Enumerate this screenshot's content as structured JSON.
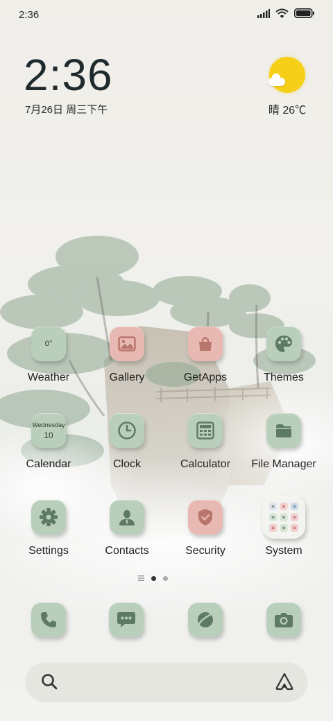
{
  "status_bar": {
    "time": "2:36",
    "icons": [
      "signal-icon",
      "wifi-icon",
      "battery-icon"
    ]
  },
  "clock_widget": {
    "time": "2:36",
    "date": "7月26日 周三下午"
  },
  "weather_widget": {
    "icon": "sunny-cloud-icon",
    "text": "晴 26℃"
  },
  "apps": [
    {
      "label": "Weather",
      "icon": "weather-icon",
      "color": "green",
      "icon_text": "0°"
    },
    {
      "label": "Gallery",
      "icon": "gallery-icon",
      "color": "pink"
    },
    {
      "label": "GetApps",
      "icon": "shopping-bag-icon",
      "color": "pink"
    },
    {
      "label": "Themes",
      "icon": "palette-icon",
      "color": "green"
    },
    {
      "label": "Calendar",
      "icon": "calendar-icon",
      "color": "green",
      "icon_text": "Wednesday",
      "icon_subtext": "10"
    },
    {
      "label": "Clock",
      "icon": "clock-icon",
      "color": "green"
    },
    {
      "label": "Calculator",
      "icon": "calculator-icon",
      "color": "green"
    },
    {
      "label": "File Manager",
      "icon": "folder-icon",
      "color": "green"
    },
    {
      "label": "Settings",
      "icon": "gear-icon",
      "color": "green"
    },
    {
      "label": "Contacts",
      "icon": "person-icon",
      "color": "green"
    },
    {
      "label": "Security",
      "icon": "shield-icon",
      "color": "pink"
    },
    {
      "label": "System",
      "icon": "folder-grid-icon",
      "color": "light"
    }
  ],
  "page_indicator": {
    "pages": 2,
    "current": 1
  },
  "dock": [
    {
      "icon": "phone-icon"
    },
    {
      "icon": "message-icon"
    },
    {
      "icon": "browser-icon"
    },
    {
      "icon": "camera-icon"
    }
  ],
  "search_bar": {
    "icon": "search-icon",
    "assistant_icon": "assistant-icon"
  },
  "colors": {
    "accent_green": "#b9cfbb",
    "accent_pink": "#e8b9b2",
    "icon_glyph_green": "#5f7a63",
    "icon_glyph_pink": "#b7756c",
    "sun": "#f6cf18"
  }
}
